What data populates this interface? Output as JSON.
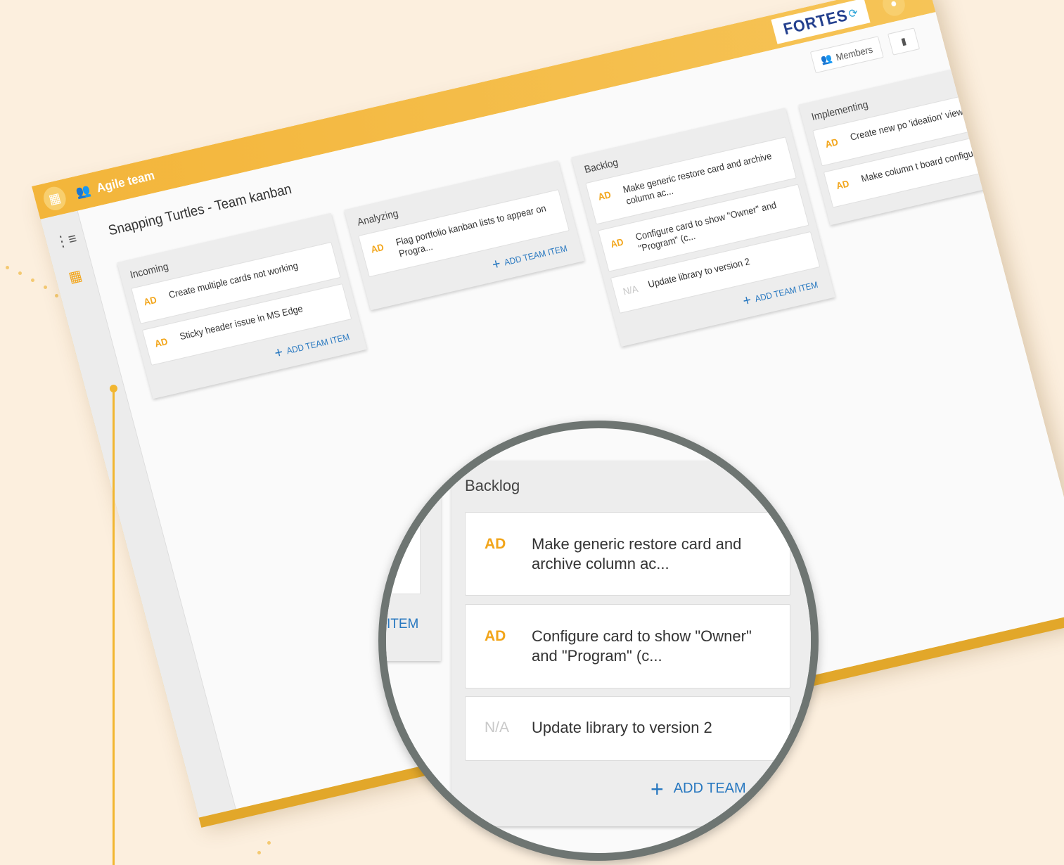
{
  "header": {
    "team_name": "Agile team",
    "logo_text": "FORTES",
    "app_launcher_icon": "grid-icon",
    "team_icon": "team-icon",
    "avatar_icon": "user-icon"
  },
  "sidebar": {
    "items": [
      {
        "icon": "hierarchy-icon"
      },
      {
        "icon": "kanban-icon",
        "active": true
      }
    ]
  },
  "board": {
    "title": "Snapping Turtles - Team kanban",
    "members_label": "Members",
    "add_item_label": "ADD TEAM ITEM",
    "columns": [
      {
        "title": "Incoming",
        "cards": [
          {
            "badge": "AD",
            "text": "Create multiple cards not working"
          },
          {
            "badge": "AD",
            "text": "Sticky header issue in MS Edge"
          }
        ]
      },
      {
        "title": "Analyzing",
        "cards": [
          {
            "badge": "AD",
            "text": "Flag portfolio kanban lists to appear on Progra..."
          }
        ]
      },
      {
        "title": "Backlog",
        "cards": [
          {
            "badge": "AD",
            "text": "Make generic restore card and archive column ac..."
          },
          {
            "badge": "AD",
            "text": "Configure card to show \"Owner\" and \"Program\" (c..."
          },
          {
            "badge": "N/A",
            "text": "Update library to version 2"
          }
        ]
      },
      {
        "title": "Implementing",
        "cards": [
          {
            "badge": "AD",
            "text": "Create new po 'ideation' view"
          },
          {
            "badge": "AD",
            "text": "Make column t board configur..."
          }
        ]
      }
    ]
  },
  "magnifier": {
    "column_title": "Backlog",
    "cards": [
      {
        "badge": "AD",
        "text": "Make generic restore card and archive column ac..."
      },
      {
        "badge": "AD",
        "text": "Configure card to show \"Owner\" and \"Program\" (c..."
      },
      {
        "badge": "N/A",
        "text": "Update library to version 2"
      }
    ],
    "left_add_fragment": "ITEM",
    "add_fragment": "ADD TEAM"
  },
  "colors": {
    "accent": "#f3b53a",
    "badge": "#f2a51a",
    "link": "#2878c0",
    "background": "#fcefde"
  }
}
